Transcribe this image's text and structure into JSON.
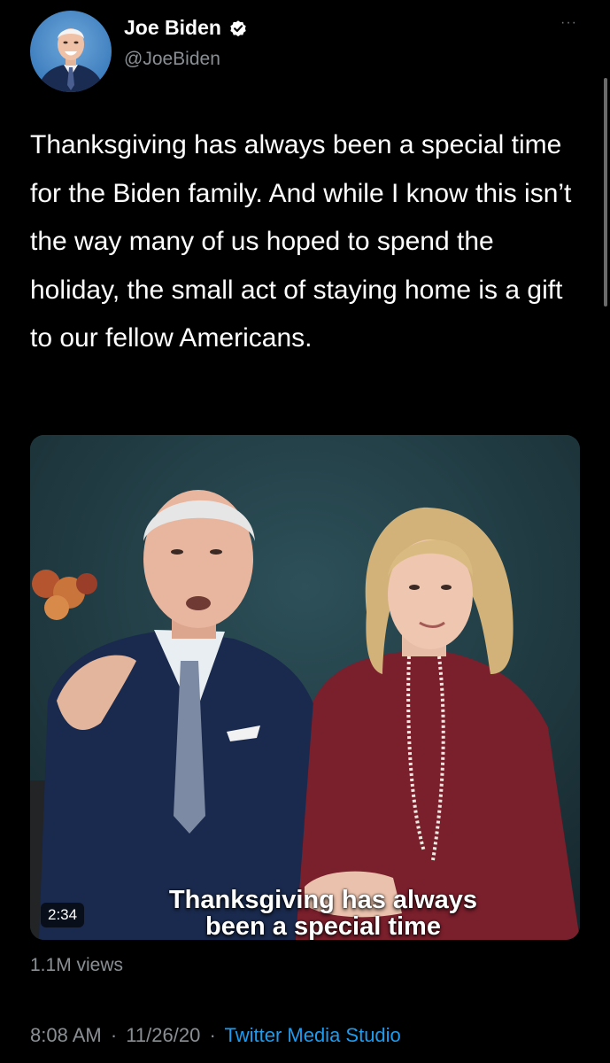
{
  "author": {
    "display_name": "Joe Biden",
    "handle": "@JoeBiden",
    "verified": true,
    "avatar_icon": "profile-photo"
  },
  "more_menu": {
    "label": "···"
  },
  "tweet": {
    "text": "Thanksgiving has always been a special time for the Biden family. And while I know this isn’t the way many of us hoped to spend the holiday, the small act of staying home is a gift to our fellow Americans."
  },
  "media": {
    "duration": "2:34",
    "caption_line1": "Thanksgiving has always",
    "caption_line2": "been a special time"
  },
  "views": "1.1M views",
  "footer": {
    "time": "8:08 AM",
    "separator": "·",
    "date": "11/26/20",
    "source": "Twitter Media Studio"
  },
  "colors": {
    "background": "#000000",
    "secondary_text": "#8a8f94",
    "link": "#1d9bf0",
    "verified_badge": "#ffffff"
  }
}
